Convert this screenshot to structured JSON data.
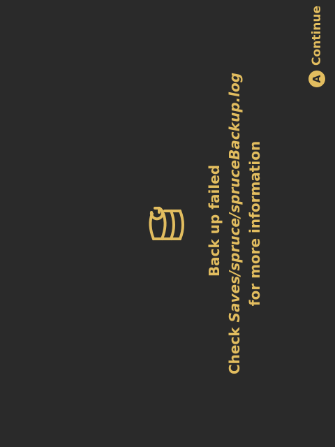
{
  "dialog": {
    "icon": "database-backup-icon",
    "title": "Back up failed",
    "check_prefix": "Check ",
    "check_path": "Saves/spruce/spruceBackup.log",
    "more_info": "for more information"
  },
  "controls": {
    "continue_button": "A",
    "continue_label": "Continue"
  },
  "colors": {
    "background": "#2a2a2a",
    "accent": "#e2bd5f"
  }
}
